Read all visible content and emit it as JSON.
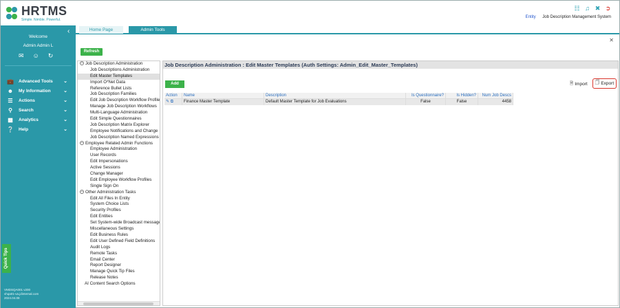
{
  "header": {
    "logo_text": "HRTMS",
    "logo_tagline": "Simple. Nimble. Powerful.",
    "entity_label": "Entity",
    "system_name": "Job Description Management System",
    "icons": [
      "sitemap-icon",
      "bell-icon",
      "tools-icon",
      "logout-icon"
    ]
  },
  "sidebar": {
    "welcome": "Welcome",
    "user_name": "Admin Admin L",
    "quick_icons": [
      "mail-icon",
      "users-icon",
      "refresh-icon"
    ],
    "menu": [
      {
        "label": "Advanced Tools",
        "icon": "briefcase-icon"
      },
      {
        "label": "My Information",
        "icon": "user-icon"
      },
      {
        "label": "Actions",
        "icon": "list-icon"
      },
      {
        "label": "Search",
        "icon": "search-icon"
      },
      {
        "label": "Analytics",
        "icon": "chart-icon"
      },
      {
        "label": "Help",
        "icon": "help-icon"
      }
    ],
    "quick_tips": "Quick Tips",
    "footer": [
      "VMDSQA001 v200",
      "vhqa01-va.jdinternal.com",
      "2024.04.08"
    ]
  },
  "tabs": {
    "home": "Home Page",
    "admin": "Admin Tools"
  },
  "toolbar": {
    "refresh": "Refresh"
  },
  "tree": {
    "groups": [
      {
        "label": "Job Description Administration",
        "items": [
          "Job Descriptions Administration",
          "Edit Master Templates",
          "Import O*Net Data",
          "Reference Bullet Lists",
          "Job Description Families",
          "Edit Job Description Workflow Profiles",
          "Manage Job Description Workflows",
          "Multi-Language Administration",
          "Edit Simple Questionnaires",
          "Job Description Matrix Explorer",
          "Employee Notifications and Change",
          "Job Description Named Expressions"
        ]
      },
      {
        "label": "Employee Related Admin Functions",
        "items": [
          "Employee Administration",
          "User Records",
          "Edit Impersonations",
          "Active Sessions",
          "Change Manager",
          "Edit Employee Workflow Profiles",
          "Single Sign On"
        ]
      },
      {
        "label": "Other Administration Tasks",
        "items": [
          "Edit All Files In Entity",
          "System Choice Lists",
          "Security Profiles",
          "Edit Entities",
          "Set System-wide Broadcast message",
          "Miscellaneous Settings",
          "Edit Business Rules",
          "Edit User Defined Field Definitions",
          "Audit Logs",
          "Remote Tasks",
          "Email Center",
          "Report Designer",
          "Manage Quick Tip Files",
          "Release Notes"
        ]
      }
    ],
    "last_item": "AI Content Search Options",
    "selected": "Edit Master Templates"
  },
  "main": {
    "title": "Job Description Administration : Edit Master Templates (Auth Settings: Admin_Edit_Master_Templates)",
    "add": "Add",
    "import": "Import",
    "export": "Export",
    "columns": [
      "Action",
      "Name",
      "Description",
      "Is Questionnaire?",
      "Is Hidden?",
      "Num Job Descs"
    ],
    "rows": [
      {
        "name": "Finance Master Template",
        "description": "Default Master Template for Job Evaluations",
        "is_questionnaire": "False",
        "is_hidden": "False",
        "num_job_descs": "4458"
      }
    ]
  },
  "colors": {
    "teal": "#2a98a8",
    "green": "#3cb24a",
    "red": "#d9342b"
  }
}
